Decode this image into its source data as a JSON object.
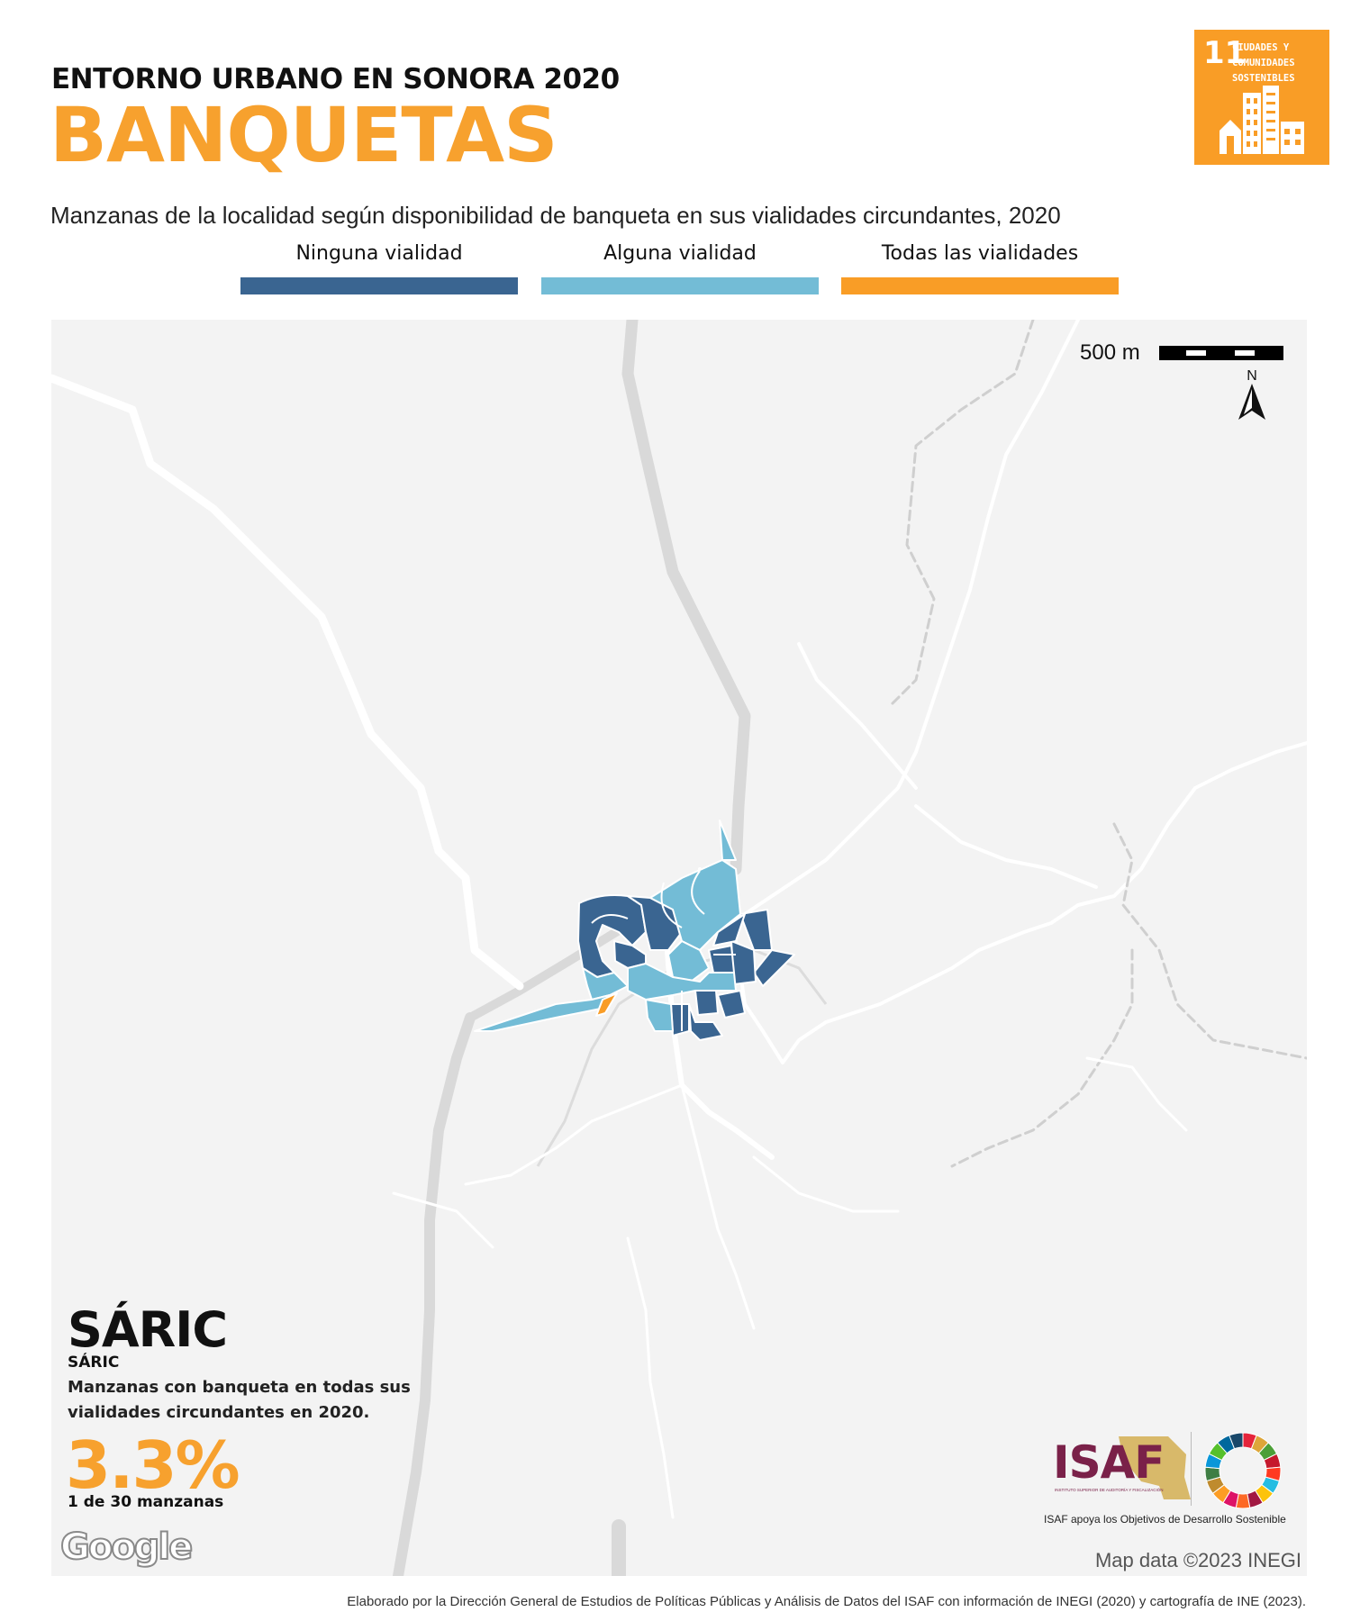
{
  "header": {
    "supertitle": "ENTORNO URBANO EN SONORA 2020",
    "title": "BANQUETAS",
    "subtitle": "Manzanas de la localidad según disponibilidad de banqueta en sus vialidades circundantes, 2020"
  },
  "legend": [
    {
      "label": "Ninguna vialidad",
      "color": "#3a6591"
    },
    {
      "label": "Alguna vialidad",
      "color": "#73bcd6"
    },
    {
      "label": "Todas las vialidades",
      "color": "#f99d26"
    }
  ],
  "sdg_badge": {
    "number": "11",
    "lines": [
      "CIUDADES Y",
      "COMUNIDADES",
      "SOSTENIBLES"
    ],
    "color": "#f99d26",
    "icon": "city-buildings-icon"
  },
  "map": {
    "scale_label": "500 m",
    "north_label": "N",
    "attribution": "Map data ©2023 INEGI",
    "provider_logo": "Google"
  },
  "locality": {
    "name": "SÁRIC",
    "subname": "SÁRIC",
    "description": "Manzanas con banqueta en todas sus vialidades circundantes en 2020.",
    "percentage": "3.3%",
    "count_text": "1 de 30 manzanas"
  },
  "logos": {
    "isaf_word": "ISAF",
    "isaf_subtext": "INSTITUTO SUPERIOR DE AUDITORÍA Y FISCALIZACIÓN",
    "isaf_tagline": "ISAF apoya los Objetivos de Desarrollo Sostenible",
    "isaf_color": "#7a2149"
  },
  "footer": {
    "credit": "Elaborado por la Dirección General de Estudios de Políticas Públicas y Análisis de Datos del ISAF con información de INEGI (2020) y cartografía de INE (2023)."
  }
}
